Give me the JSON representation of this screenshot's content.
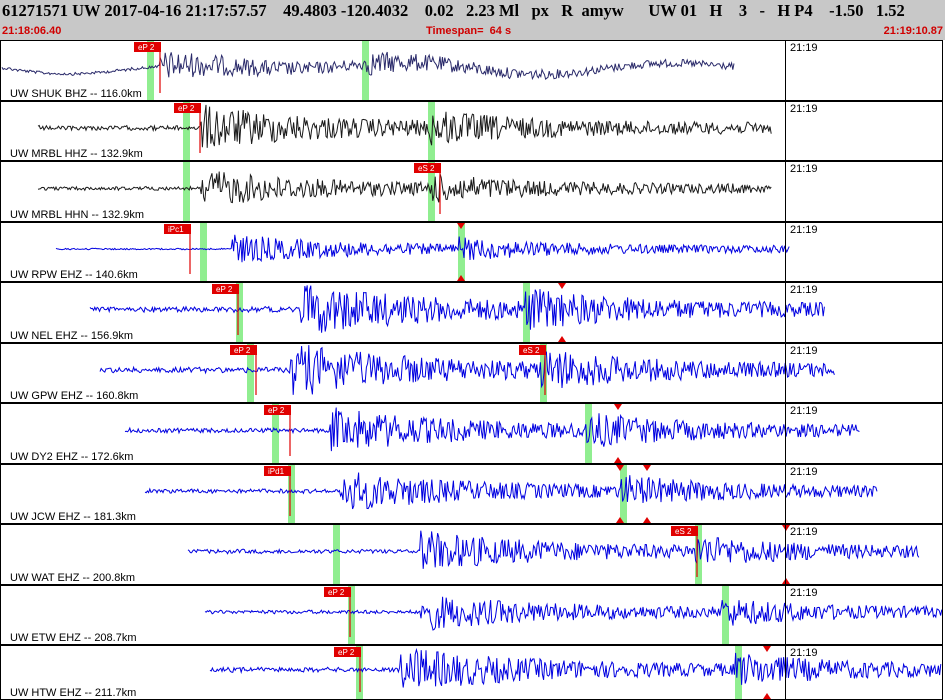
{
  "header": {
    "title": "61271571 UW 2017-04-16 21:17:57.57    49.4803 -120.4032    0.02   2.23 Ml   px   R  amyw      UW 01   H    3   -   H P4    -1.50   1.52",
    "start_time": "21:18:06.40",
    "timespan": "Timespan=  64 s",
    "end_time": "21:19:10.87"
  },
  "colors": {
    "header_bg": "#c8c8c8",
    "trace_black": "#1a1a1a",
    "trace_navy": "#2a2a6a",
    "trace_blue": "#0000e0",
    "pick": "#e00000",
    "window": "#90ee90"
  },
  "traces": [
    {
      "label": "UW SHUK BHZ -- 116.0km",
      "time": "21:19",
      "color": "navy",
      "picks": [
        {
          "label": "eP 2",
          "type": "P"
        }
      ],
      "markers": []
    },
    {
      "label": "UW MRBL HHZ -- 132.9km",
      "time": "21:19",
      "color": "black",
      "picks": [
        {
          "label": "eP 2",
          "type": "P"
        }
      ],
      "markers": []
    },
    {
      "label": "UW MRBL HHN -- 132.9km",
      "time": "21:19",
      "color": "black",
      "picks": [
        {
          "label": "eS 2",
          "type": "S"
        }
      ],
      "markers": []
    },
    {
      "label": "UW RPW EHZ -- 140.6km",
      "time": "21:19",
      "color": "blue",
      "picks": [
        {
          "label": "iPc1",
          "type": "P"
        }
      ],
      "markers": [
        "S"
      ]
    },
    {
      "label": "UW NEL EHZ -- 156.9km",
      "time": "21:19",
      "color": "blue",
      "picks": [
        {
          "label": "eP 2",
          "type": "P"
        }
      ],
      "markers": [
        "S"
      ]
    },
    {
      "label": "UW GPW EHZ -- 160.8km",
      "time": "21:19",
      "color": "blue",
      "picks": [
        {
          "label": "eP 2",
          "type": "P"
        },
        {
          "label": "eS 2",
          "type": "S"
        }
      ],
      "markers": []
    },
    {
      "label": "UW DY2 EHZ -- 172.6km",
      "time": "21:19",
      "color": "blue",
      "picks": [
        {
          "label": "eP 2",
          "type": "P"
        }
      ],
      "markers": [
        "S"
      ]
    },
    {
      "label": "UW JCW EHZ -- 181.3km",
      "time": "21:19",
      "color": "blue",
      "picks": [
        {
          "label": "iPd1",
          "type": "P"
        }
      ],
      "markers": [
        "S",
        "S2"
      ]
    },
    {
      "label": "UW WAT EHZ -- 200.8km",
      "time": "21:19",
      "color": "blue",
      "picks": [
        {
          "label": "eS 2",
          "type": "S"
        }
      ],
      "markers": [
        "S"
      ]
    },
    {
      "label": "UW ETW EHZ -- 208.7km",
      "time": "21:19",
      "color": "blue",
      "picks": [
        {
          "label": "eP 2",
          "type": "P"
        }
      ],
      "markers": []
    },
    {
      "label": "UW HTW EHZ -- 211.7km",
      "time": "21:19",
      "color": "blue",
      "picks": [
        {
          "label": "eP 2",
          "type": "P"
        }
      ],
      "markers": [
        "S"
      ]
    }
  ]
}
